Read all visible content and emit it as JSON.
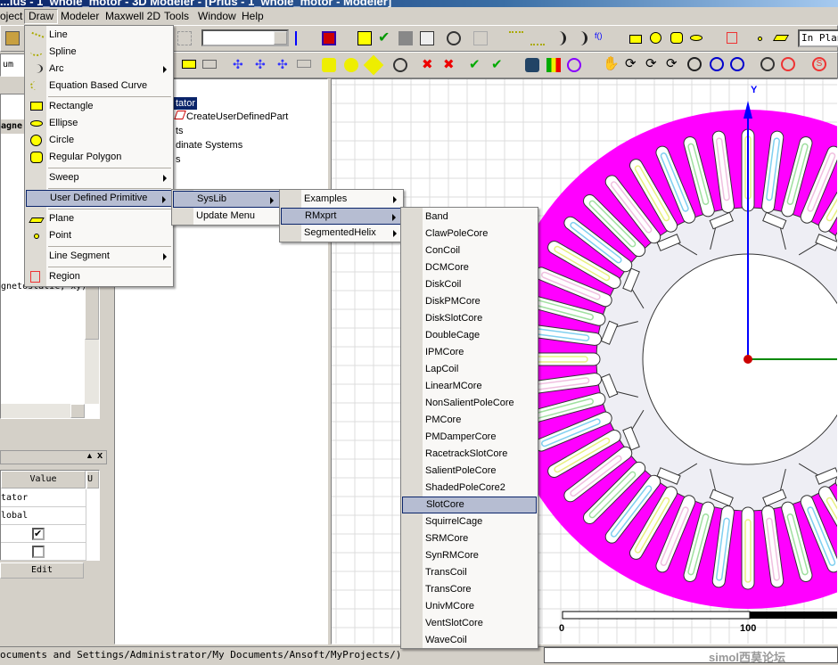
{
  "title": "...lus - 1_whole_motor - 3D Modeler - [Prius - 1_whole_motor - Modeler]",
  "menubar": [
    "oject",
    "Draw",
    "Modeler",
    "Maxwell 2D",
    "Tools",
    "Window",
    "Help"
  ],
  "toolbar": {
    "combo_value": "",
    "plane_field": "In Plan"
  },
  "left": {
    "units_field": "um",
    "header_fragment": "agne",
    "tree_fragment": "gnetostatic, xy)"
  },
  "tree": {
    "selected": "tator",
    "items": [
      "CreateUserDefinedPart",
      "ts",
      "dinate Systems",
      "s"
    ]
  },
  "props": {
    "col_value": "Value",
    "col_unit": "U",
    "rows": [
      "tator",
      "lobal"
    ],
    "visible_checked": true,
    "other_checked": false,
    "edit_button": "Edit"
  },
  "status": {
    "path": "ocuments and Settings/Administrator/My Documents/Ansoft/MyProjects/)"
  },
  "viewport": {
    "y_axis": "Y",
    "scale_labels": [
      "0",
      "100"
    ],
    "stator_color": "#ff00ff",
    "watermark": "simol西莫论坛"
  },
  "draw_menu": [
    {
      "label": "Line",
      "icon": "line-icon"
    },
    {
      "label": "Spline",
      "icon": "spline-icon"
    },
    {
      "label": "Arc",
      "icon": "arc-icon",
      "submenu": true
    },
    {
      "label": "Equation Based Curve",
      "icon": "equation-curve-icon"
    },
    "-",
    {
      "label": "Rectangle",
      "icon": "rectangle-icon"
    },
    {
      "label": "Ellipse",
      "icon": "ellipse-icon"
    },
    {
      "label": "Circle",
      "icon": "circle-icon"
    },
    {
      "label": "Regular Polygon",
      "icon": "polygon-icon"
    },
    "-",
    {
      "label": "Sweep",
      "submenu": true
    },
    "-",
    {
      "label": "User Defined Primitive",
      "submenu": true,
      "highlighted": true
    },
    "-",
    {
      "label": "Plane",
      "icon": "plane-icon"
    },
    {
      "label": "Point",
      "icon": "point-icon"
    },
    "-",
    {
      "label": "Line Segment",
      "submenu": true
    },
    "-",
    {
      "label": "Region",
      "icon": "region-icon"
    }
  ],
  "syslib_menu": [
    {
      "label": "SysLib",
      "submenu": true,
      "highlighted": true
    },
    {
      "label": "Update Menu"
    }
  ],
  "lib_menu": [
    {
      "label": "Examples",
      "submenu": true
    },
    {
      "label": "RMxprt",
      "submenu": true,
      "highlighted": true
    },
    {
      "label": "SegmentedHelix",
      "submenu": true
    }
  ],
  "rmxprt_menu": [
    "Band",
    "ClawPoleCore",
    "ConCoil",
    "DCMCore",
    "DiskCoil",
    "DiskPMCore",
    "DiskSlotCore",
    "DoubleCage",
    "IPMCore",
    "LapCoil",
    "LinearMCore",
    "NonSalientPoleCore",
    "PMCore",
    "PMDamperCore",
    "RacetrackSlotCore",
    "SalientPoleCore",
    "ShadedPoleCore2",
    "SlotCore",
    "SquirrelCage",
    "SRMCore",
    "SynRMCore",
    "TransCoil",
    "TransCore",
    "UnivMCore",
    "VentSlotCore",
    "WaveCoil"
  ],
  "rmxprt_highlighted": "SlotCore"
}
